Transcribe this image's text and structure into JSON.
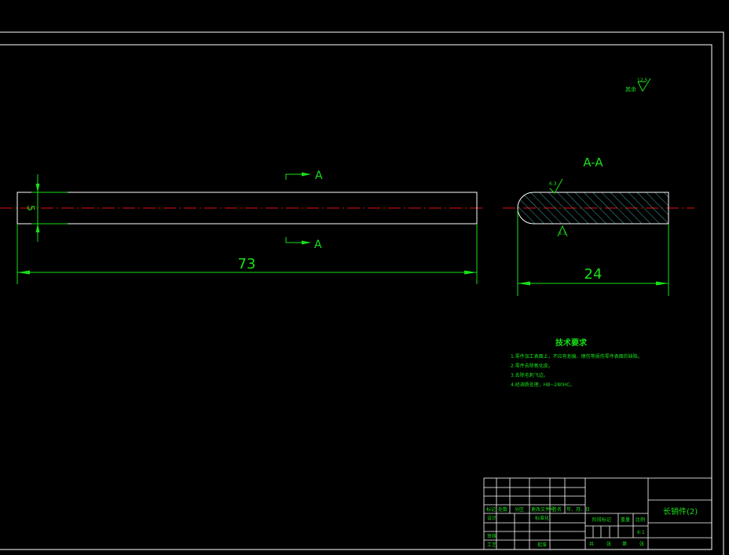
{
  "colors": {
    "background": "#000000",
    "outline": "#ffffff",
    "dimension": "#19e019",
    "centerline": "#e01010",
    "hatch": "#3fa6a6"
  },
  "drawing": {
    "diameter_label": "5",
    "length_label": "73",
    "width_label": "24",
    "section_marker": "A",
    "section_title": "A-A",
    "surface_finish_top": "6.3",
    "surface_finish_bottom": "6.3",
    "surface_finish_rest": "其余",
    "surface_finish_rest_value": "12.5"
  },
  "notes": {
    "title": "技术要求",
    "items": [
      "1.零件加工表面上，不应有划痕、擦伤等损伤零件表面的缺陷。",
      "2.零件去除氧化皮。",
      "3.去除毛刺飞边。",
      "4.经调质处理，HB~280HC。"
    ]
  },
  "title_block": {
    "part_name": "长销件(2)",
    "scale": "6:1",
    "row_labels": {
      "mark": "标记",
      "count": "处数",
      "zone": "分区",
      "doc_no": "更改文件号",
      "sign": "签名",
      "date": "年、月、日",
      "design": "设计",
      "standardize": "标准化",
      "review": "审核",
      "process": "工艺",
      "approve": "批准",
      "stage_mark": "阶段标记",
      "weight": "重量",
      "ratio": "比例",
      "sheets_total": "共",
      "sheets_total_unit": "张",
      "sheet_no": "第",
      "sheet_no_unit": "张"
    }
  }
}
